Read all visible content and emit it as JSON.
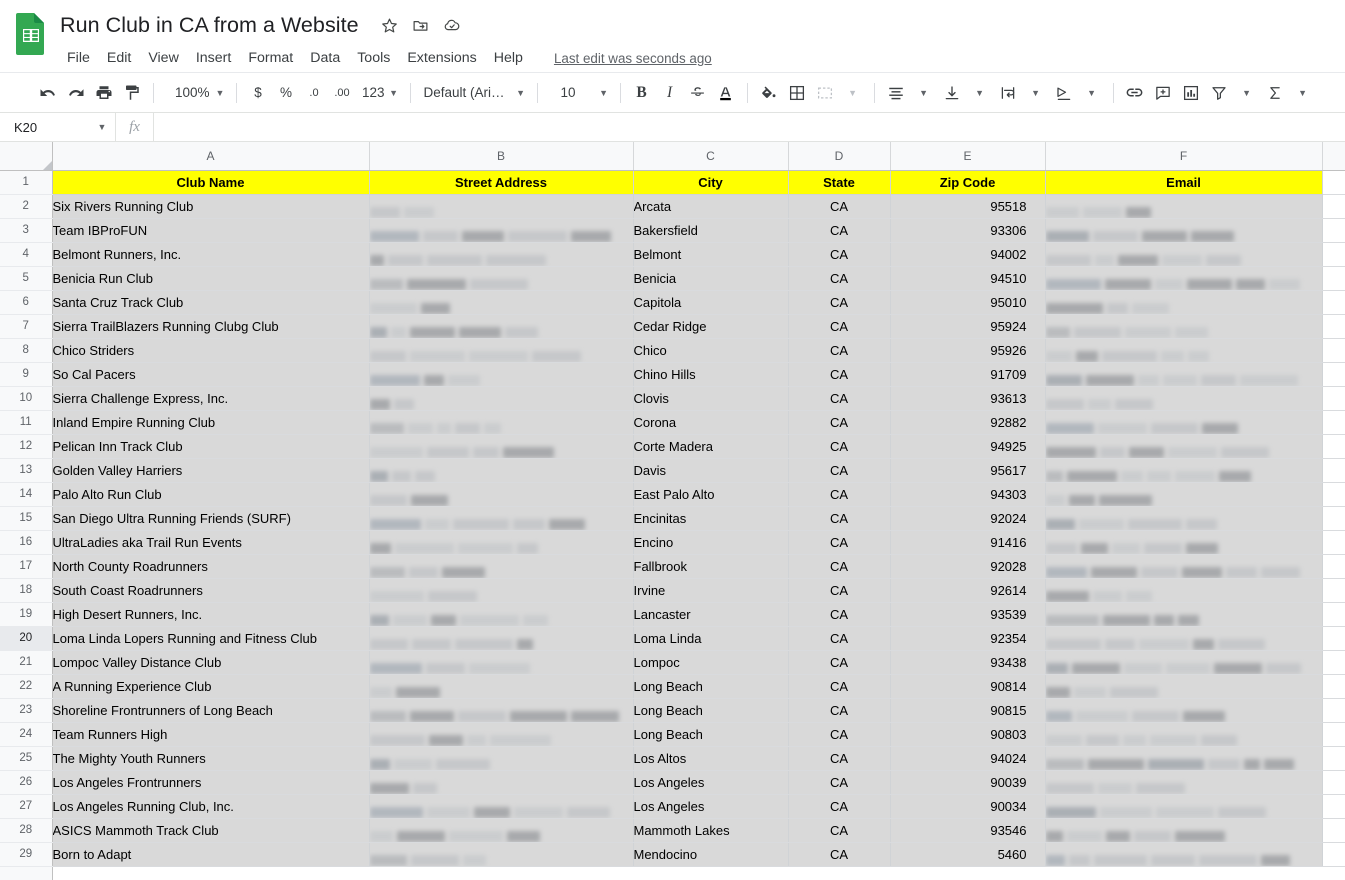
{
  "app": {
    "logo_name": "google-sheets-logo",
    "brand_color": "#33a852"
  },
  "titlebar": {
    "doc_title": "Run Club in CA from a Website",
    "icons": [
      {
        "name": "star-icon",
        "label": "Star"
      },
      {
        "name": "move-to-folder-icon",
        "label": "Move"
      },
      {
        "name": "cloud-saved-icon",
        "label": "Saved to Drive"
      }
    ],
    "menus": [
      "File",
      "Edit",
      "View",
      "Insert",
      "Format",
      "Data",
      "Tools",
      "Extensions",
      "Help"
    ],
    "last_edit": "Last edit was seconds ago"
  },
  "toolbar": {
    "undo": "undo-icon",
    "redo": "redo-icon",
    "print": "print-icon",
    "paint_format": "paint-format-icon",
    "zoom_value": "100%",
    "currency": "$",
    "percent": "%",
    "decrease_decimal": ".0",
    "increase_decimal": ".00",
    "number_format": "123",
    "font_family": "Default (Ari…",
    "font_size": "10",
    "bold": "B",
    "italic": "I",
    "strikethrough": "S",
    "text_color": "A",
    "fill_color": "fill-color-icon",
    "borders": "borders-icon",
    "merge_cells": "merge-cells-icon",
    "horizontal_align": "horizontal-align-icon",
    "vertical_align": "vertical-align-icon",
    "text_wrap": "text-wrap-icon",
    "text_rotation": "text-rotation-icon",
    "insert_link": "insert-link-icon",
    "insert_comment": "insert-comment-icon",
    "insert_chart": "insert-chart-icon",
    "create_filter": "filter-icon",
    "functions": "functions-sigma-icon"
  },
  "formulabar": {
    "name_box_value": "K20",
    "fx_label": "fx",
    "formula_value": ""
  },
  "grid": {
    "columns": [
      "A",
      "B",
      "C",
      "D",
      "E",
      "F"
    ],
    "header_row_number": "1",
    "header_fill": "#ffff00",
    "headers": [
      "Club Name",
      "Street Address",
      "City",
      "State",
      "Zip Code",
      "Email"
    ],
    "rows": [
      {
        "n": "2",
        "club": "Six Rivers Running Club",
        "address": "",
        "city": "Arcata",
        "state": "CA",
        "zip": "95518",
        "email": ""
      },
      {
        "n": "3",
        "club": "Team IBProFUN",
        "address": "",
        "city": "Bakersfield",
        "state": "CA",
        "zip": "93306",
        "email": ""
      },
      {
        "n": "4",
        "club": "Belmont Runners, Inc.",
        "address": "",
        "city": "Belmont",
        "state": "CA",
        "zip": "94002",
        "email": ""
      },
      {
        "n": "5",
        "club": "Benicia Run Club",
        "address": "",
        "city": "Benicia",
        "state": "CA",
        "zip": "94510",
        "email": ""
      },
      {
        "n": "6",
        "club": "Santa Cruz Track Club",
        "address": "",
        "city": "Capitola",
        "state": "CA",
        "zip": "95010",
        "email": ""
      },
      {
        "n": "7",
        "club": "Sierra TrailBlazers Running Clubg Club",
        "address": "",
        "city": "Cedar Ridge",
        "state": "CA",
        "zip": "95924",
        "email": ""
      },
      {
        "n": "8",
        "club": "Chico Striders",
        "address": "",
        "city": "Chico",
        "state": "CA",
        "zip": "95926",
        "email": ""
      },
      {
        "n": "9",
        "club": "So Cal Pacers",
        "address": "",
        "city": "Chino Hills",
        "state": "CA",
        "zip": "91709",
        "email": ""
      },
      {
        "n": "10",
        "club": "Sierra Challenge Express, Inc.",
        "address": "",
        "city": "Clovis",
        "state": "CA",
        "zip": "93613",
        "email": ""
      },
      {
        "n": "11",
        "club": "Inland Empire Running Club",
        "address": "",
        "city": "Corona",
        "state": "CA",
        "zip": "92882",
        "email": ""
      },
      {
        "n": "12",
        "club": "Pelican Inn Track Club",
        "address": "",
        "city": "Corte Madera",
        "state": "CA",
        "zip": "94925",
        "email": ""
      },
      {
        "n": "13",
        "club": "Golden Valley Harriers",
        "address": "",
        "city": "Davis",
        "state": "CA",
        "zip": "95617",
        "email": ""
      },
      {
        "n": "14",
        "club": "Palo Alto Run Club",
        "address": "",
        "city": "East Palo Alto",
        "state": "CA",
        "zip": "94303",
        "email": ""
      },
      {
        "n": "15",
        "club": "San Diego Ultra Running Friends (SURF)",
        "address": "",
        "city": "Encinitas",
        "state": "CA",
        "zip": "92024",
        "email": ""
      },
      {
        "n": "16",
        "club": "UltraLadies aka Trail Run Events",
        "address": "",
        "city": "Encino",
        "state": "CA",
        "zip": "91416",
        "email": ""
      },
      {
        "n": "17",
        "club": "North County Roadrunners",
        "address": "",
        "city": "Fallbrook",
        "state": "CA",
        "zip": "92028",
        "email": ""
      },
      {
        "n": "18",
        "club": "South Coast Roadrunners",
        "address": "",
        "city": "Irvine",
        "state": "CA",
        "zip": "92614",
        "email": ""
      },
      {
        "n": "19",
        "club": "High Desert Runners, Inc.",
        "address": "",
        "city": "Lancaster",
        "state": "CA",
        "zip": "93539",
        "email": ""
      },
      {
        "n": "20",
        "club": "Loma Linda Lopers Running and Fitness Club",
        "address": "",
        "city": "Loma Linda",
        "state": "CA",
        "zip": "92354",
        "email": ""
      },
      {
        "n": "21",
        "club": "Lompoc Valley Distance Club",
        "address": "",
        "city": "Lompoc",
        "state": "CA",
        "zip": "93438",
        "email": ""
      },
      {
        "n": "22",
        "club": "A Running Experience Club",
        "address": "",
        "city": "Long Beach",
        "state": "CA",
        "zip": "90814",
        "email": ""
      },
      {
        "n": "23",
        "club": "Shoreline Frontrunners of Long Beach",
        "address": "",
        "city": "Long Beach",
        "state": "CA",
        "zip": "90815",
        "email": ""
      },
      {
        "n": "24",
        "club": "Team Runners High",
        "address": "",
        "city": "Long Beach",
        "state": "CA",
        "zip": "90803",
        "email": ""
      },
      {
        "n": "25",
        "club": "The Mighty Youth Runners",
        "address": "",
        "city": "Los Altos",
        "state": "CA",
        "zip": "94024",
        "email": ""
      },
      {
        "n": "26",
        "club": "Los Angeles Frontrunners",
        "address": "",
        "city": "Los Angeles",
        "state": "CA",
        "zip": "90039",
        "email": ""
      },
      {
        "n": "27",
        "club": "Los Angeles Running Club, Inc.",
        "address": "",
        "city": "Los Angeles",
        "state": "CA",
        "zip": "90034",
        "email": ""
      },
      {
        "n": "28",
        "club": "ASICS Mammoth Track Club",
        "address": "",
        "city": "Mammoth Lakes",
        "state": "CA",
        "zip": "93546",
        "email": ""
      },
      {
        "n": "29",
        "club": "Born to Adapt",
        "address": "",
        "city": "Mendocino",
        "state": "CA",
        "zip": "5460",
        "email": ""
      }
    ],
    "redacted_columns": [
      "Street Address",
      "Email"
    ],
    "highlighted_row_number": "20"
  }
}
